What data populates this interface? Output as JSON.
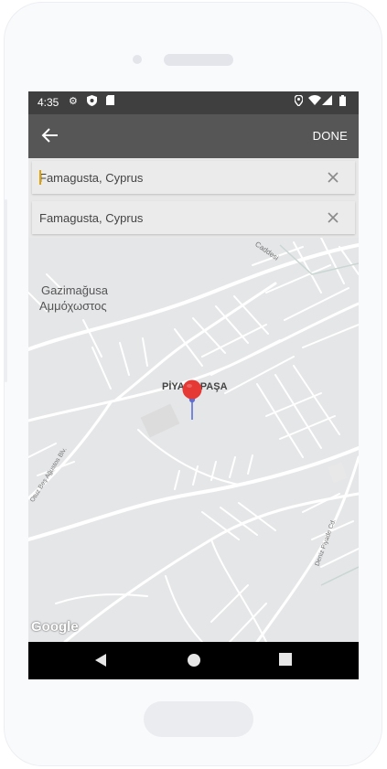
{
  "status_bar": {
    "time": "4:35",
    "left_icons": [
      "gear-icon",
      "shield-icon",
      "sd-card-icon"
    ],
    "right_icons": [
      "location-icon",
      "wifi-icon",
      "signal-icon",
      "battery-icon"
    ]
  },
  "toolbar": {
    "back_icon": "arrow-left-icon",
    "done_label": "DONE"
  },
  "search": {
    "from_value": "Famagusta, Cyprus",
    "to_value": "Famagusta, Cyprus",
    "clear_icon": "close-icon"
  },
  "map": {
    "label_city_1": "Gazimağusa",
    "label_city_2": "Αμμόχωστος",
    "label_district": "PİYALE PAŞA",
    "road_caddesi": "Caddesi",
    "road_left": "Otuz Beş Ağustos Blv.",
    "road_right": "Deniz Piyade Cd.",
    "attribution": "Google",
    "pin_color": "#e53935"
  },
  "nav_bar": {
    "back_icon": "triangle-back-icon",
    "home_icon": "circle-home-icon",
    "recents_icon": "square-recents-icon"
  }
}
